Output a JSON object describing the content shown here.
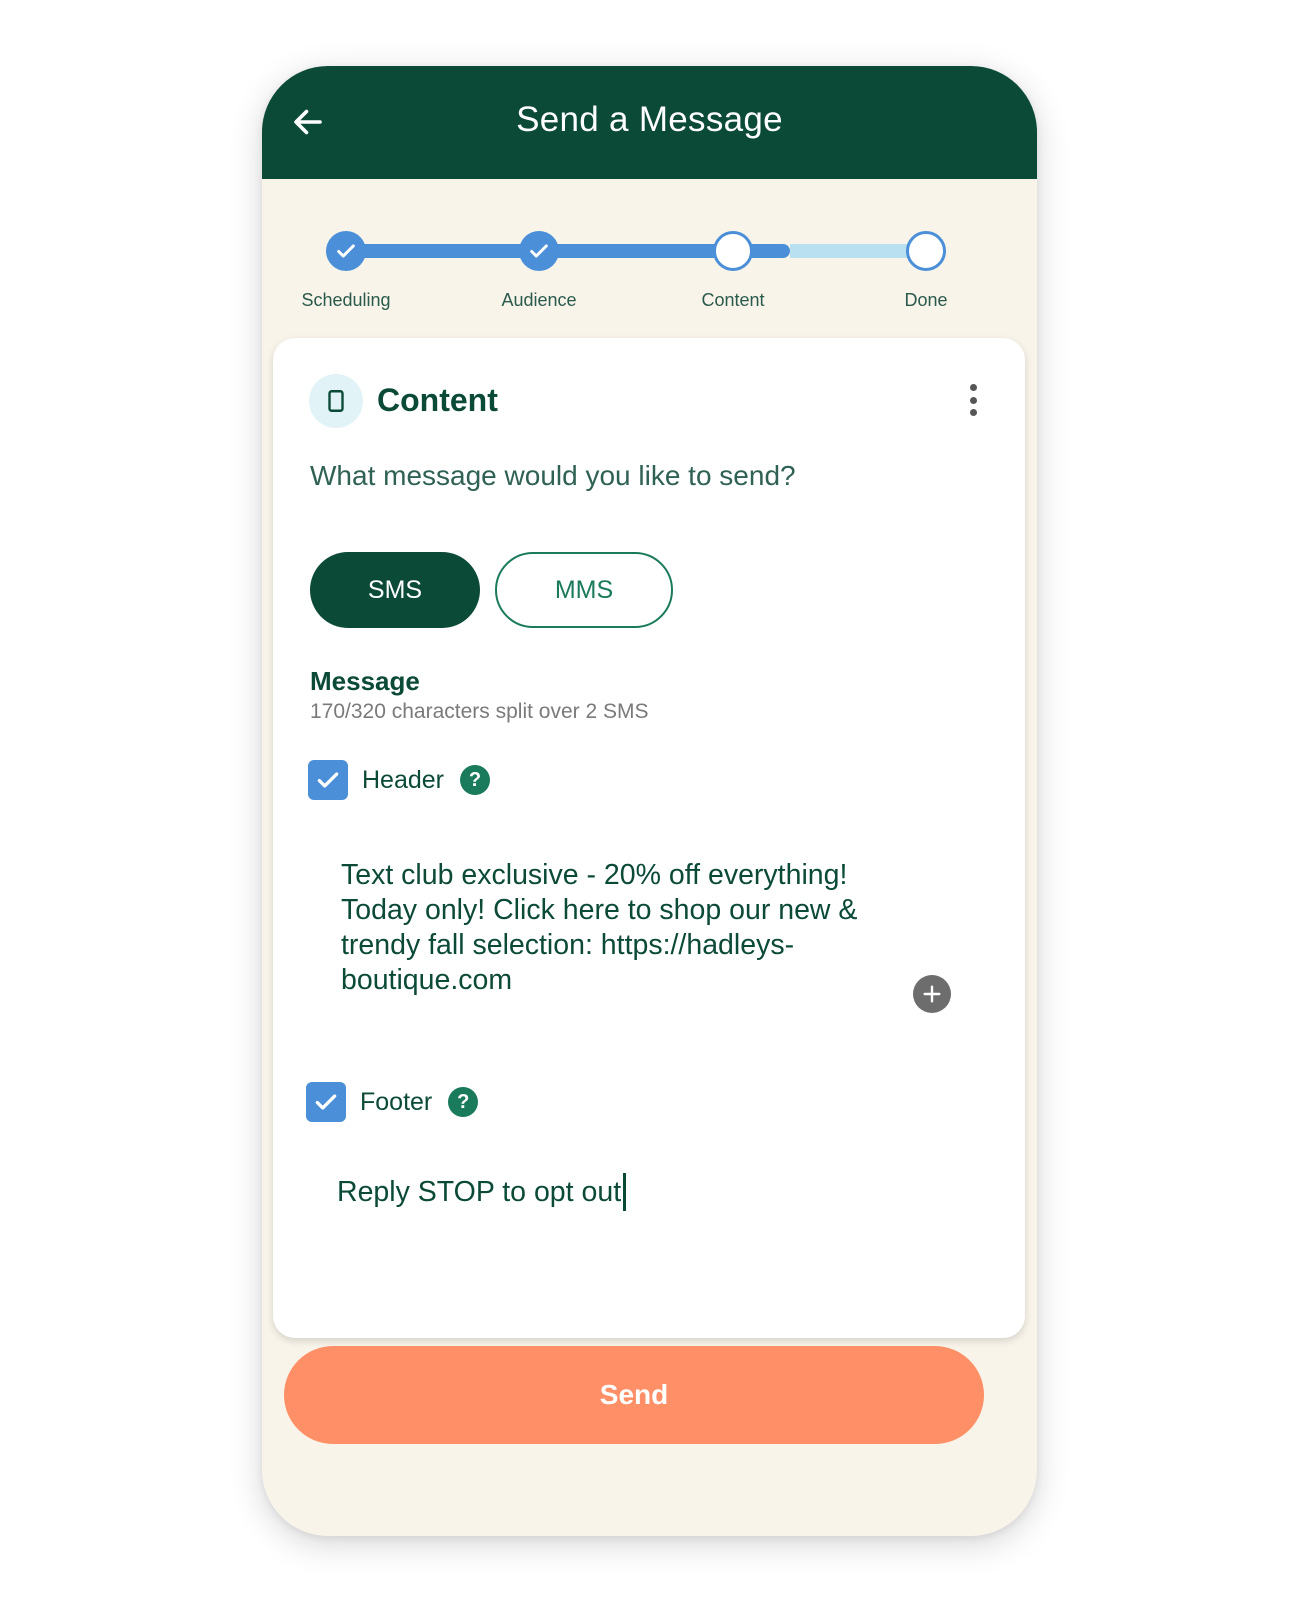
{
  "appbar": {
    "title": "Send a Message",
    "back_icon": "arrow-left-icon"
  },
  "stepper": {
    "steps": [
      {
        "label": "Scheduling",
        "state": "done"
      },
      {
        "label": "Audience",
        "state": "done"
      },
      {
        "label": "Content",
        "state": "current"
      },
      {
        "label": "Done",
        "state": "upcoming"
      }
    ]
  },
  "card": {
    "title": "Content",
    "icon": "mobile-phone-icon",
    "menu_icon": "more-vertical-icon",
    "question": "What message would you like to send?",
    "message_type": {
      "options": [
        "SMS",
        "MMS"
      ],
      "selected": "SMS"
    },
    "message_label": "Message",
    "char_count": "170/320 characters split over 2 SMS",
    "header": {
      "label": "Header",
      "checked": true,
      "help": "?"
    },
    "body": "Text club exclusive - 20% off everything! Today only! Click here to shop our new & trendy fall selection: https://hadleys-boutique.com",
    "add_icon": "plus-circle-icon",
    "footer": {
      "label": "Footer",
      "checked": true,
      "help": "?",
      "text": "Reply STOP to opt out"
    }
  },
  "send_label": "Send",
  "colors": {
    "primary_dark": "#0c4a38",
    "accent_green": "#1a7a5c",
    "step_blue": "#4a8fd8",
    "track_light": "#b8e0f0",
    "send_orange": "#ff8f66",
    "background": "#f8f4ea"
  }
}
